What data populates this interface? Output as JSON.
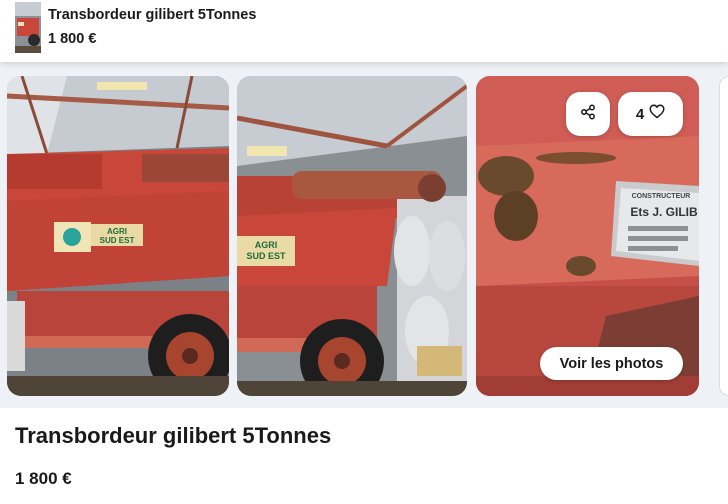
{
  "header": {
    "title": "Transbordeur gilibert 5Tonnes",
    "price": "1 800 €"
  },
  "gallery": {
    "favorite_count": "4",
    "view_photos_label": "Voir les photos",
    "photo1_sign_left": "AGRI",
    "photo1_sign_right": "SUD EST",
    "photo2_sign_top": "AGRI",
    "photo2_sign_bottom": "SUD EST",
    "plate_title": "CONSTRUCTEUR",
    "plate_brand": "Ets J. GILIB"
  },
  "listing": {
    "title": "Transbordeur gilibert 5Tonnes",
    "price": "1 800 €"
  },
  "icons": {
    "share": "share-icon",
    "favorite": "heart-icon"
  },
  "colors": {
    "machine_red": "#c8463a",
    "text": "#1a1a1a",
    "background": "#ffffff"
  }
}
